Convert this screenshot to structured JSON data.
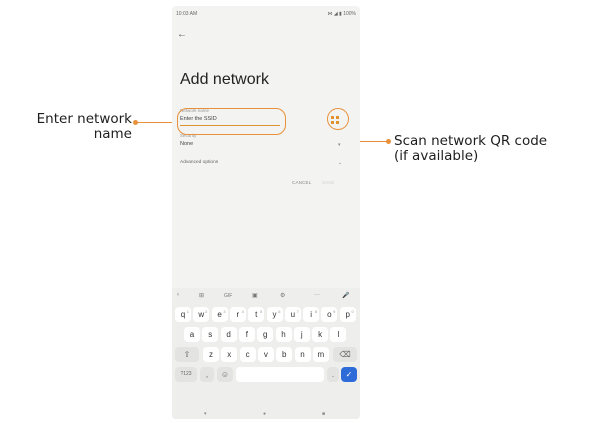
{
  "annotations": {
    "left": "Enter network\nname",
    "right": "Scan network QR code\n(if available)",
    "accent": "#e8913a"
  },
  "status": {
    "time": "10:03 AM",
    "icons": "⋈ ◢ ▮ 100%"
  },
  "screen": {
    "back_icon": "←",
    "title": "Add network",
    "name_label": "Network name",
    "name_placeholder": "Enter the SSID",
    "security_label": "Security",
    "security_value": "None",
    "advanced_label": "Advanced options",
    "cancel": "CANCEL",
    "save": "SAVE",
    "qr_icon": "qr-scan-icon"
  },
  "keyboard": {
    "toolbar": [
      "‹",
      "⊞",
      "GIF",
      "▣",
      "⚙",
      "···",
      "🎤"
    ],
    "row1": [
      {
        "k": "q",
        "s": "1"
      },
      {
        "k": "w",
        "s": "2"
      },
      {
        "k": "e",
        "s": "3"
      },
      {
        "k": "r",
        "s": "4"
      },
      {
        "k": "t",
        "s": "5"
      },
      {
        "k": "y",
        "s": "6"
      },
      {
        "k": "u",
        "s": "7"
      },
      {
        "k": "i",
        "s": "8"
      },
      {
        "k": "o",
        "s": "9"
      },
      {
        "k": "p",
        "s": "0"
      }
    ],
    "row2": [
      "a",
      "s",
      "d",
      "f",
      "g",
      "h",
      "j",
      "k",
      "l"
    ],
    "row3": [
      "z",
      "x",
      "c",
      "v",
      "b",
      "n",
      "m"
    ],
    "shift": "⇧",
    "backspace": "⌫",
    "sym": "?123",
    "comma": ",",
    "emoji": "☺",
    "period": ".",
    "enter": "✓"
  },
  "navbar": {
    "back": "▾",
    "home": "●",
    "recents": "■"
  }
}
